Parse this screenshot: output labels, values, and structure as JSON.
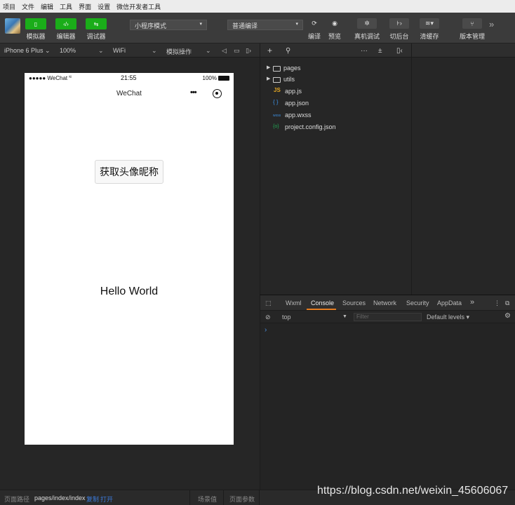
{
  "menubar": [
    "项目",
    "文件",
    "编辑",
    "工具",
    "界面",
    "设置",
    "微信开发者工具"
  ],
  "toolbar": {
    "simulator": "模拟器",
    "editor": "编辑器",
    "debugger": "调试器",
    "mode_select": "小程序模式",
    "compile_select": "普通编译",
    "compile": "编译",
    "preview": "预览",
    "real_debug": "真机调试",
    "background": "切后台",
    "clear_cache": "清缓存",
    "version": "版本管理",
    "more": "»"
  },
  "device_bar": {
    "device": "iPhone 6 Plus ⌄",
    "zoom": "100%",
    "network": "WiFi",
    "simulate": "模拟操作"
  },
  "phone": {
    "carrier": "●●●●● WeChat",
    "time": "21:55",
    "battery": "100%",
    "nav_title": "WeChat",
    "nav_dots": "•••",
    "button_label": "获取头像昵称",
    "hello_text": "Hello World"
  },
  "explorer": {
    "files": [
      {
        "name": "pages",
        "type": "folder"
      },
      {
        "name": "utils",
        "type": "folder"
      },
      {
        "name": "app.js",
        "type": "js",
        "badge": "JS",
        "color": "#e5a823"
      },
      {
        "name": "app.json",
        "type": "json",
        "badge": "{ }",
        "color": "#3c8fe0"
      },
      {
        "name": "app.wxss",
        "type": "wxss",
        "badge": "wxss",
        "color": "#3c8fe0"
      },
      {
        "name": "project.config.json",
        "type": "config",
        "badge": "{o}",
        "color": "#21a453"
      }
    ]
  },
  "devtools": {
    "tabs": [
      "Wxml",
      "Console",
      "Sources",
      "Network",
      "Security",
      "AppData"
    ],
    "active_tab": "Console",
    "context": "top",
    "filter_placeholder": "Filter",
    "levels": "Default levels ▾",
    "prompt": "›"
  },
  "bottombar": {
    "path_label": "页面路径",
    "path": "pages/index/index",
    "copy": "复制",
    "open": "打开",
    "scene": "场景值",
    "params": "页面参数"
  },
  "watermark": "https://blog.csdn.net/weixin_45606067",
  "colors": {
    "accent_green": "#1aad19",
    "tab_underline": "#e67e22",
    "link_blue": "#3c7ad9"
  }
}
